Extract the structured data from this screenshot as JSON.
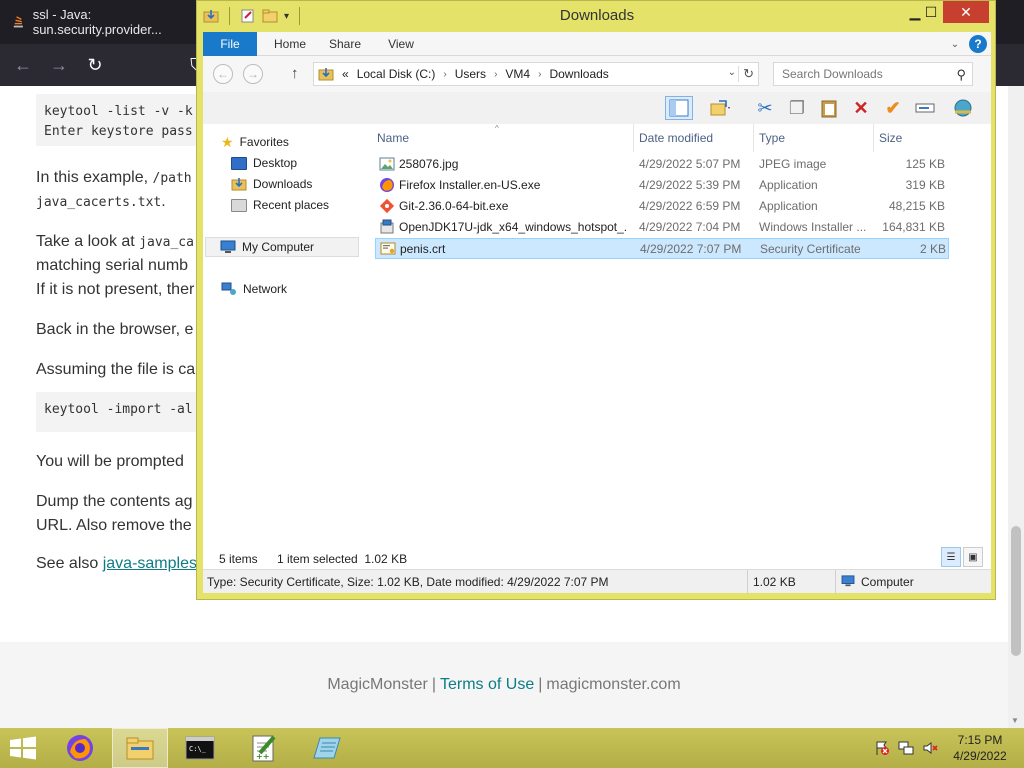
{
  "browser": {
    "tab_title": "ssl - Java: sun.security.provider...",
    "code1_line1": "keytool -list -v -k",
    "code1_line2": "Enter keystore pass",
    "p1_text": "In this example, ",
    "p1_code": "/path",
    "p1_code2": "java_cacerts.txt",
    "p1_end": ".",
    "p2_text": "Take a look at ",
    "p2_code": "java_ca",
    "p2_line2": "matching serial numb",
    "p2_line3": "If it is not present, ther",
    "p3_text": "Back in the browser, e",
    "p4_text": "Assuming the file is ca",
    "code2_line1": "keytool -import -al",
    "p5_text": "You will be prompted",
    "p6_line1": "Dump the contents ag",
    "p6_line2": "URL. Also remove the",
    "p7_text": "See also ",
    "p7_link": "java-samples",
    "footer": {
      "brand": "MagicMonster",
      "sep1": "|",
      "terms": "Terms of Use",
      "sep2": "|",
      "domain": "magicmonster.com"
    }
  },
  "explorer": {
    "title": "Downloads",
    "ribbon": {
      "file": "File",
      "home": "Home",
      "share": "Share",
      "view": "View",
      "help": "?"
    },
    "address": {
      "overflow": "«",
      "crumbs": [
        "Local Disk (C:)",
        "Users",
        "VM4",
        "Downloads"
      ]
    },
    "search_placeholder": "Search Downloads",
    "nav": {
      "favorites": "Favorites",
      "desktop": "Desktop",
      "downloads": "Downloads",
      "recent": "Recent places",
      "computer": "My Computer",
      "network": "Network"
    },
    "columns": {
      "name": "Name",
      "date": "Date modified",
      "type": "Type",
      "size": "Size"
    },
    "files": [
      {
        "name": "258076.jpg",
        "date": "4/29/2022 5:07 PM",
        "type": "JPEG image",
        "size": "125 KB",
        "icon": "image-icon"
      },
      {
        "name": "Firefox Installer.en-US.exe",
        "date": "4/29/2022 5:39 PM",
        "type": "Application",
        "size": "319 KB",
        "icon": "firefox-icon"
      },
      {
        "name": "Git-2.36.0-64-bit.exe",
        "date": "4/29/2022 6:59 PM",
        "type": "Application",
        "size": "48,215 KB",
        "icon": "git-icon"
      },
      {
        "name": "OpenJDK17U-jdk_x64_windows_hotspot_...",
        "date": "4/29/2022 7:04 PM",
        "type": "Windows Installer ...",
        "size": "164,831 KB",
        "icon": "installer-icon"
      },
      {
        "name": "penis.crt",
        "date": "4/29/2022 7:07 PM",
        "type": "Security Certificate",
        "size": "2 KB",
        "icon": "certificate-icon"
      }
    ],
    "status": {
      "items": "5 items",
      "selected": "1 item selected  1.02 KB"
    },
    "details": {
      "text": "Type: Security Certificate, Size: 1.02 KB, Date modified: 4/29/2022 7:07 PM",
      "size": "1.02 KB",
      "location": "Computer"
    }
  },
  "taskbar": {
    "time": "7:15 PM",
    "date": "4/29/2022"
  },
  "colors": {
    "window_frame": "#e5e269",
    "file_tab": "#1979ca",
    "selection": "#cce8ff",
    "close_button": "#c7402f",
    "taskbar": "#c8c45a"
  }
}
